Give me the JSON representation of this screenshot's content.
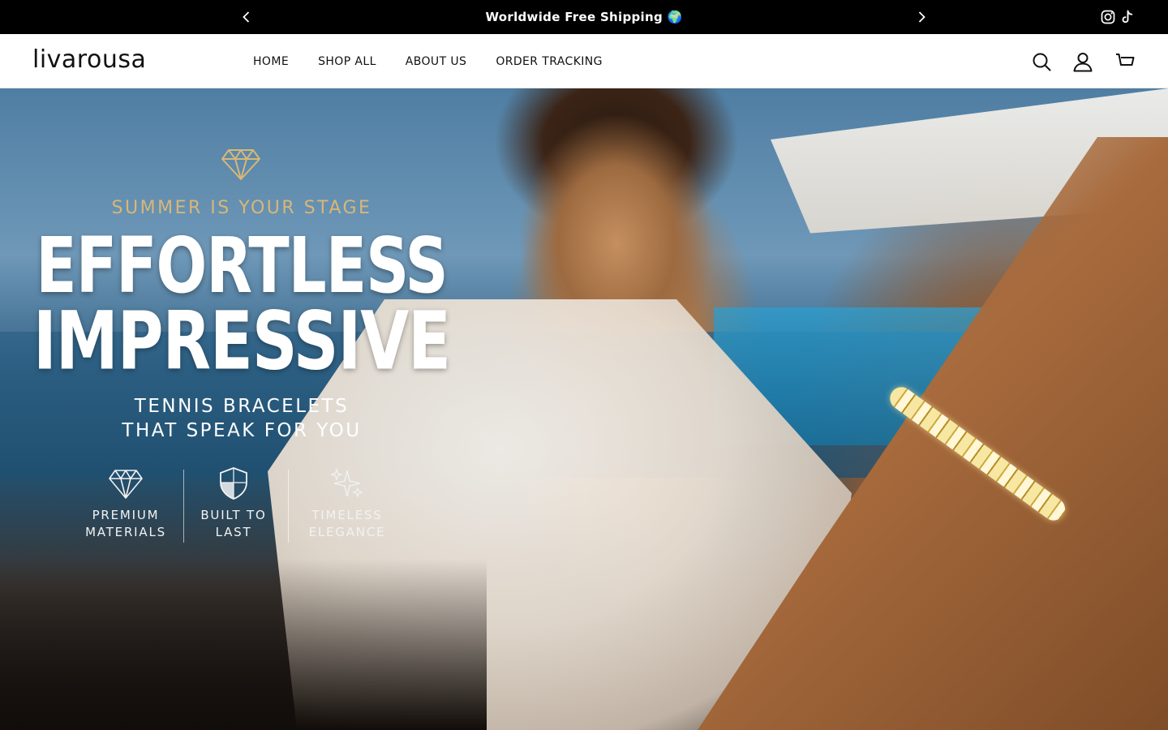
{
  "announcement": {
    "message": "Worldwide Free Shipping 🌍",
    "prev_icon": "chevron-left-icon",
    "next_icon": "chevron-right-icon",
    "social": [
      "instagram-icon",
      "tiktok-icon"
    ]
  },
  "header": {
    "logo": "livarousa",
    "nav": [
      "HOME",
      "SHOP ALL",
      "ABOUT US",
      "ORDER TRACKING"
    ],
    "icons": [
      "search-icon",
      "account-icon",
      "cart-icon"
    ]
  },
  "hero": {
    "kicker": "SUMMER IS YOUR STAGE",
    "headline_1": "EFFORTLESS",
    "headline_2": "IMPRESSIVE",
    "subline_1": "TENNIS BRACELETS",
    "subline_2": "THAT SPEAK FOR YOU",
    "features": [
      {
        "line1": "PREMIUM",
        "line2": "MATERIALS",
        "icon": "diamond-icon"
      },
      {
        "line1": "BUILT TO",
        "line2": "LAST",
        "icon": "shield-icon"
      },
      {
        "line1": "TIMELESS",
        "line2": "ELEGANCE",
        "icon": "sparkle-icon"
      }
    ],
    "accent_color": "#d8b777"
  }
}
